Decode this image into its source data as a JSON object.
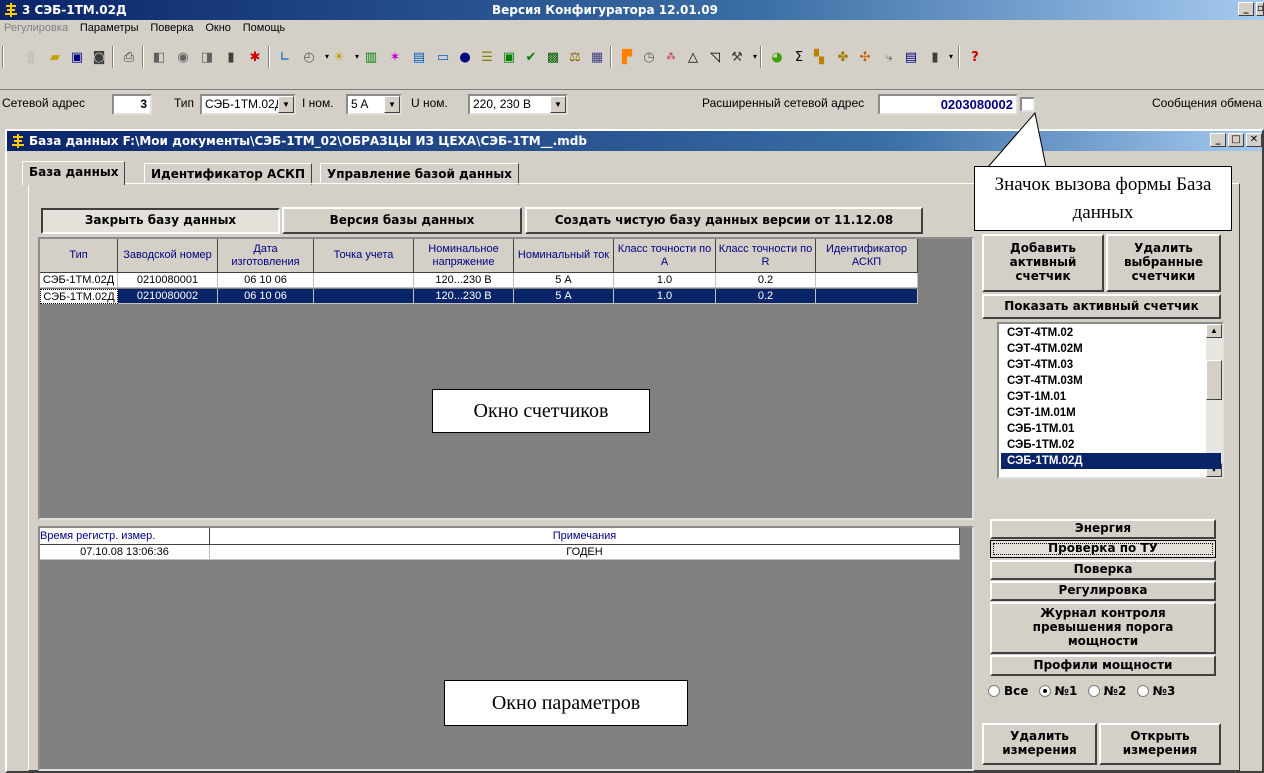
{
  "app": {
    "title": "3 СЭБ-1ТМ.02Д",
    "version": "Версия Конфигуратора  12.01.09"
  },
  "menu": [
    "Регулировка",
    "Параметры",
    "Поверка",
    "Окно",
    "Помощь"
  ],
  "params": {
    "address_label": "Сетевой адрес",
    "address_value": "3",
    "type_label": "Тип",
    "type_value": "СЭБ-1ТМ.02Д",
    "inom_label": "I ном.",
    "inom_value": "5 A",
    "unom_label": "U ном.",
    "unom_value": "220, 230 В",
    "ext_address_label": "Расширенный сетевой адрес",
    "ext_address_value": "0203080002",
    "messages_label": "Сообщения обмена"
  },
  "child": {
    "title": "База данных F:\\Мои документы\\СЭБ-1ТМ_02\\ОБРАЗЦЫ ИЗ ЦЕХА\\СЭБ-1ТМ__.mdb",
    "tabs": [
      "База данных",
      "Идентификатор АСКП",
      "Управление базой данных"
    ]
  },
  "buttons": {
    "close_db": "Закрыть базу данных",
    "db_version": "Версия базы данных",
    "create_db": "Создать чистую базу данных версии от 11.12.08",
    "add_active": "Добавить активный счетчик",
    "delete_selected": "Удалить выбранные счетчики",
    "show_active": "Показать активный счетчик",
    "energy": "Энергия",
    "check_tu": "Проверка по ТУ",
    "verification": "Поверка",
    "adjustment": "Регулировка",
    "journal": "Журнал контроля превышения порога мощности",
    "power_profiles": "Профили мощности",
    "delete_meas": "Удалить измерения",
    "open_meas": "Открыть измерения"
  },
  "meters_table": {
    "headers": [
      "Тип",
      "Заводской номер",
      "Дата изготовления",
      "Точка учета",
      "Номинальное напряжение",
      "Номинальный ток",
      "Класс точности по А",
      "Класс точности по R",
      "Идентификатор АСКП"
    ],
    "rows": [
      [
        "СЭБ-1ТМ.02Д",
        "0210080001",
        "06 10 06",
        "",
        "120...230 В",
        "5 А",
        "1.0",
        "0.2",
        ""
      ],
      [
        "СЭБ-1ТМ.02Д",
        "0210080002",
        "06 10 06",
        "",
        "120...230 В",
        "5 А",
        "1.0",
        "0.2",
        ""
      ]
    ],
    "selected_row": 1
  },
  "meter_types": [
    "СЭТ-4ТМ.02",
    "СЭТ-4ТМ.02М",
    "СЭТ-4ТМ.03",
    "СЭТ-4ТМ.03М",
    "СЭТ-1М.01",
    "СЭТ-1М.01М",
    "СЭБ-1ТМ.01",
    "СЭБ-1ТМ.02",
    "СЭБ-1ТМ.02Д"
  ],
  "meter_types_selected": 8,
  "params_table": {
    "headers": [
      "Время регистр. измер.",
      "Примечания"
    ],
    "rows": [
      [
        "07.10.08 13:06:36",
        "ГОДЕН"
      ]
    ]
  },
  "radios": {
    "options": [
      "Все",
      "№1",
      "№2",
      "№3"
    ],
    "selected": 1
  },
  "annotations": {
    "meters_window": "Окно счетчиков",
    "params_window": "Окно параметров",
    "db_icon_callout": "Значок вызова формы База данных"
  }
}
